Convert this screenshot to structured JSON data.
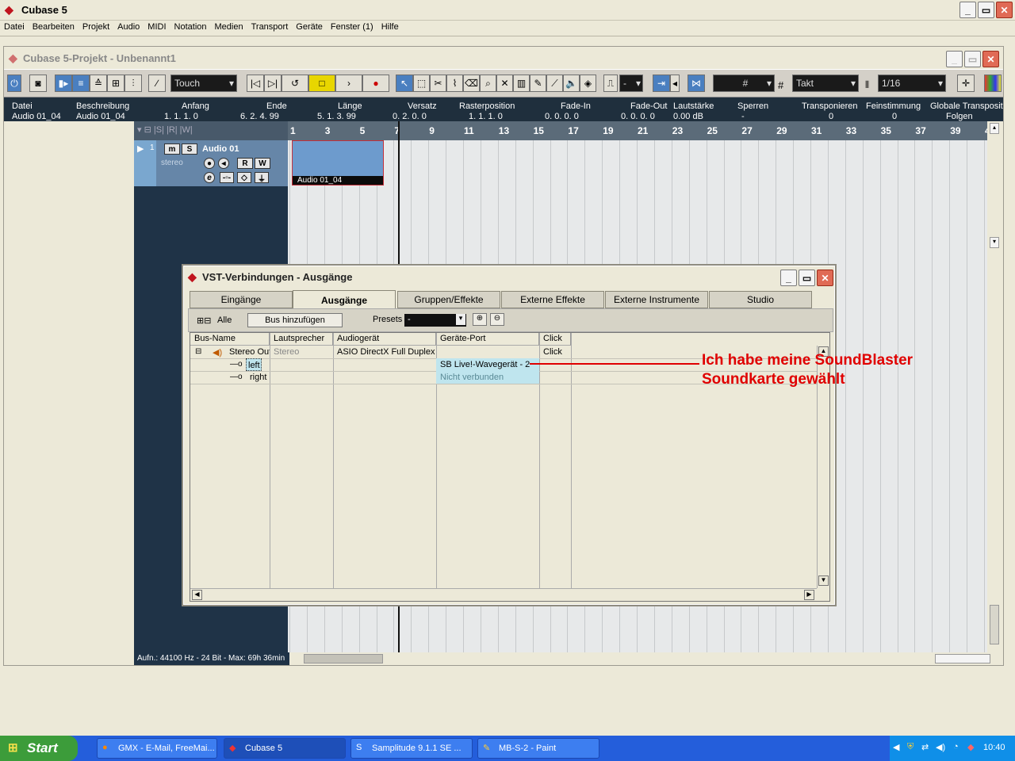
{
  "app": {
    "title": "Cubase 5",
    "min": "_",
    "max": "▭",
    "close": "✕"
  },
  "menu": [
    "Datei",
    "Bearbeiten",
    "Projekt",
    "Audio",
    "MIDI",
    "Notation",
    "Medien",
    "Transport",
    "Geräte",
    "Fenster (1)",
    "Hilfe"
  ],
  "project": {
    "title": "Cubase 5-Projekt - Unbenannt1",
    "automation_mode": "Touch",
    "quantize_label": "Takt",
    "quantize_value": "1/16",
    "snap_value": "-",
    "grid_value": "#"
  },
  "infoline": {
    "headers": [
      "Datei",
      "Beschreibung",
      "Anfang",
      "Ende",
      "Länge",
      "Versatz",
      "Rasterposition",
      "Fade-In",
      "Fade-Out",
      "Lautstärke",
      "Sperren",
      "Transponieren",
      "Feinstimmung",
      "Globale Transposit"
    ],
    "values": [
      "Audio 01_04",
      "Audio 01_04",
      "1. 1. 1.   0",
      "6. 2. 4. 99",
      "5. 1. 3. 99",
      "0. 2. 0.   0",
      "1. 1. 1.   0",
      "0. 0. 0.   0",
      "0. 0. 0.   0",
      "0.00 dB",
      "-",
      "0",
      "0",
      "Folgen"
    ]
  },
  "track": {
    "number": "1",
    "name": "Audio 01",
    "type": "stereo",
    "btn_m": "m",
    "btn_s": "S",
    "btn_r": "R",
    "btn_w": "W",
    "btn_e": "e"
  },
  "ruler": [
    "1",
    "3",
    "5",
    "7",
    "9",
    "11",
    "13",
    "15",
    "17",
    "19",
    "21",
    "23",
    "25",
    "27",
    "29",
    "31",
    "33",
    "35",
    "37",
    "39",
    "4"
  ],
  "event": {
    "name": "Audio 01_04"
  },
  "status": "Aufn.: 44100 Hz - 24 Bit - Max: 69h 36min",
  "vst": {
    "title": "VST-Verbindungen - Ausgänge",
    "tabs": [
      "Eingänge",
      "Ausgänge",
      "Gruppen/Effekte",
      "Externe Effekte",
      "Externe Instrumente",
      "Studio"
    ],
    "all_label": "Alle",
    "add_bus": "Bus hinzufügen",
    "presets_label": "Presets",
    "presets_value": "-",
    "columns": [
      "Bus-Name",
      "Lautsprecher",
      "Audiogerät",
      "Geräte-Port",
      "Click"
    ],
    "rows": [
      {
        "bus": "Stereo Out",
        "speaker": "Stereo",
        "device": "ASIO DirectX Full Duplex D",
        "port": "",
        "click": "Click"
      },
      {
        "bus": "left",
        "speaker": "",
        "device": "",
        "port": "SB Live!-Wavegerät - 2",
        "click": ""
      },
      {
        "bus": "right",
        "speaker": "",
        "device": "",
        "port": "Nicht verbunden",
        "click": ""
      }
    ]
  },
  "annotation": {
    "line1": "Ich habe meine SoundBlaster",
    "line2": "Soundkarte gewählt"
  },
  "taskbar": {
    "start": "Start",
    "tasks": [
      "GMX - E-Mail, FreeMai...",
      "Cubase 5",
      "Samplitude 9.1.1 SE  ...",
      "MB-S-2 - Paint"
    ],
    "clock": "10:40"
  },
  "colors": {
    "accent": "#c0141e",
    "annotation": "#e00000",
    "xp_blue": "#245edb"
  }
}
